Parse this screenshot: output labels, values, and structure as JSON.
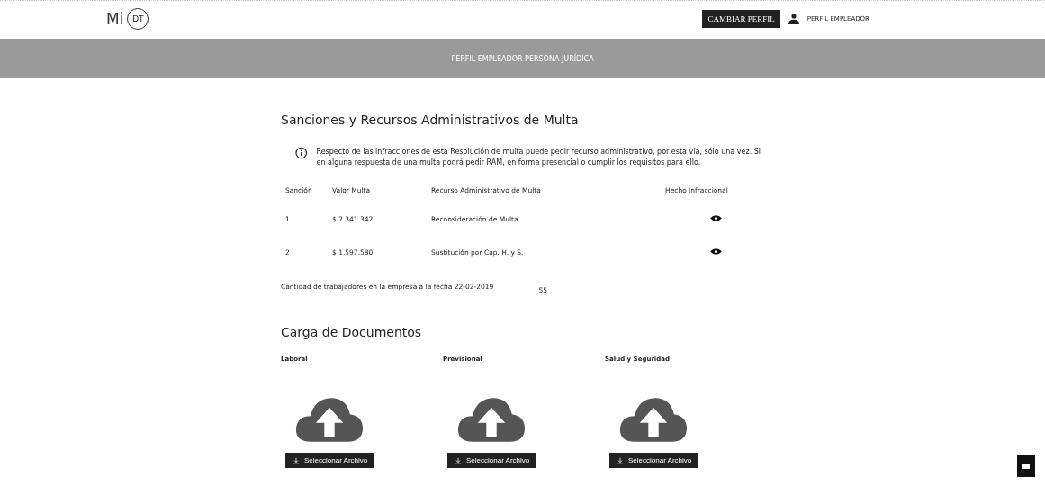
{
  "header": {
    "logo_prefix": "Mi",
    "logo_badge": "DT",
    "switch_button": "CAMBIAR PERFIL",
    "profile": "PERFIL EMPLEADOR"
  },
  "banner": "PERFIL EMPLEADOR PERSONA JURÍDICA",
  "sanctions": {
    "title": "Sanciones y Recursos Administrativos de Multa",
    "notice": "Respecto de las infracciones de esta Resolución de multa puede pedir recurso administrativo, por esta vía, sólo una vez. Si en alguna respuesta de una multa podrá pedir RAM, en forma presencial o cumplir los requisitos para ello.",
    "columns": [
      "Sanción",
      "Valor Multa",
      "Recurso Administrativo de Multa",
      "Hecho Infraccional"
    ],
    "rows": [
      {
        "number": "1",
        "amount": "$ 2.341.342",
        "resource": "Reconsideración de Multa"
      },
      {
        "number": "2",
        "amount": "$ 1.597.580",
        "resource": "Sustitución por Cap. H. y S."
      }
    ],
    "workers_label": "Cantidad de trabajadores en la empresa a la fecha 22-02-2019",
    "workers_value": "55"
  },
  "documents": {
    "title": "Carga de Documentos",
    "groups": [
      {
        "label": "Laboral",
        "button": "Seleccionar Archivo"
      },
      {
        "label": "Previsional",
        "button": "Seleccionar Archivo"
      },
      {
        "label": "Salud y Seguridad",
        "button": "Seleccionar Archivo"
      }
    ]
  }
}
